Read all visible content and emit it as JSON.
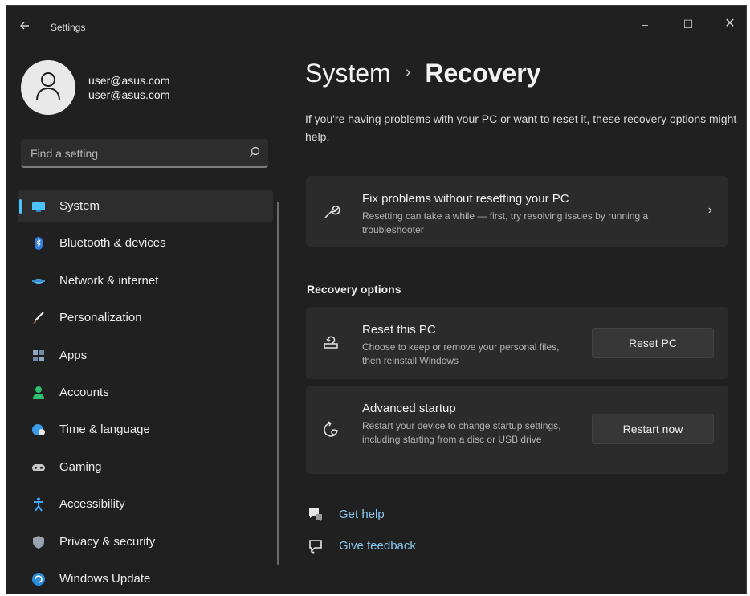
{
  "window": {
    "title": "Settings",
    "controls": [
      "–",
      "☐",
      "✕"
    ]
  },
  "user": {
    "name": "user@asus.com",
    "email": "user@asus.com"
  },
  "search": {
    "placeholder": "Find a setting"
  },
  "sidebar": {
    "items": [
      {
        "label": "System",
        "icon": "monitor-icon",
        "active": true,
        "color": "#4cc2ff"
      },
      {
        "label": "Bluetooth & devices",
        "icon": "bluetooth-icon",
        "active": false,
        "color": "#2f7fe0"
      },
      {
        "label": "Network & internet",
        "icon": "wifi-icon",
        "active": false,
        "color": "#58b5f0"
      },
      {
        "label": "Personalization",
        "icon": "brush-icon",
        "active": false,
        "color": "#e07b3a"
      },
      {
        "label": "Apps",
        "icon": "apps-icon",
        "active": false,
        "color": "#8fa6c0"
      },
      {
        "label": "Accounts",
        "icon": "person-icon",
        "active": false,
        "color": "#2fbf71"
      },
      {
        "label": "Time & language",
        "icon": "globe-clock-icon",
        "active": false,
        "color": "#3a9be8"
      },
      {
        "label": "Gaming",
        "icon": "gamepad-icon",
        "active": false,
        "color": "#c6c6c6"
      },
      {
        "label": "Accessibility",
        "icon": "accessibility-icon",
        "active": false,
        "color": "#3aa6ff"
      },
      {
        "label": "Privacy & security",
        "icon": "shield-icon",
        "active": false,
        "color": "#9aa3ad"
      },
      {
        "label": "Windows Update",
        "icon": "update-icon",
        "active": false,
        "color": "#2b8de0"
      }
    ]
  },
  "main": {
    "breadcrumb_parent": "System",
    "breadcrumb_separator": "›",
    "breadcrumb_current": "Recovery",
    "intro": "If you're having problems with your PC or want to reset it, these recovery options might help.",
    "fix_card": {
      "title": "Fix problems without resetting your PC",
      "description": "Resetting can take a while — first, try resolving issues by running a troubleshooter",
      "chevron": "›"
    },
    "section_title": "Recovery options",
    "reset_card": {
      "title": "Reset this PC",
      "description": "Choose to keep or remove your personal files, then reinstall Windows",
      "button": "Reset PC"
    },
    "advanced_card": {
      "title": "Advanced startup",
      "description": "Restart your device to change startup settings, including starting from a disc or USB drive",
      "button": "Restart now"
    },
    "links": [
      {
        "label": "Get help",
        "icon": "help-chat-icon"
      },
      {
        "label": "Give feedback",
        "icon": "feedback-icon"
      }
    ]
  },
  "colors": {
    "accent": "#4cc2ff",
    "link": "#8ac6ea",
    "background": "#202020",
    "card": "#2b2b2b"
  }
}
